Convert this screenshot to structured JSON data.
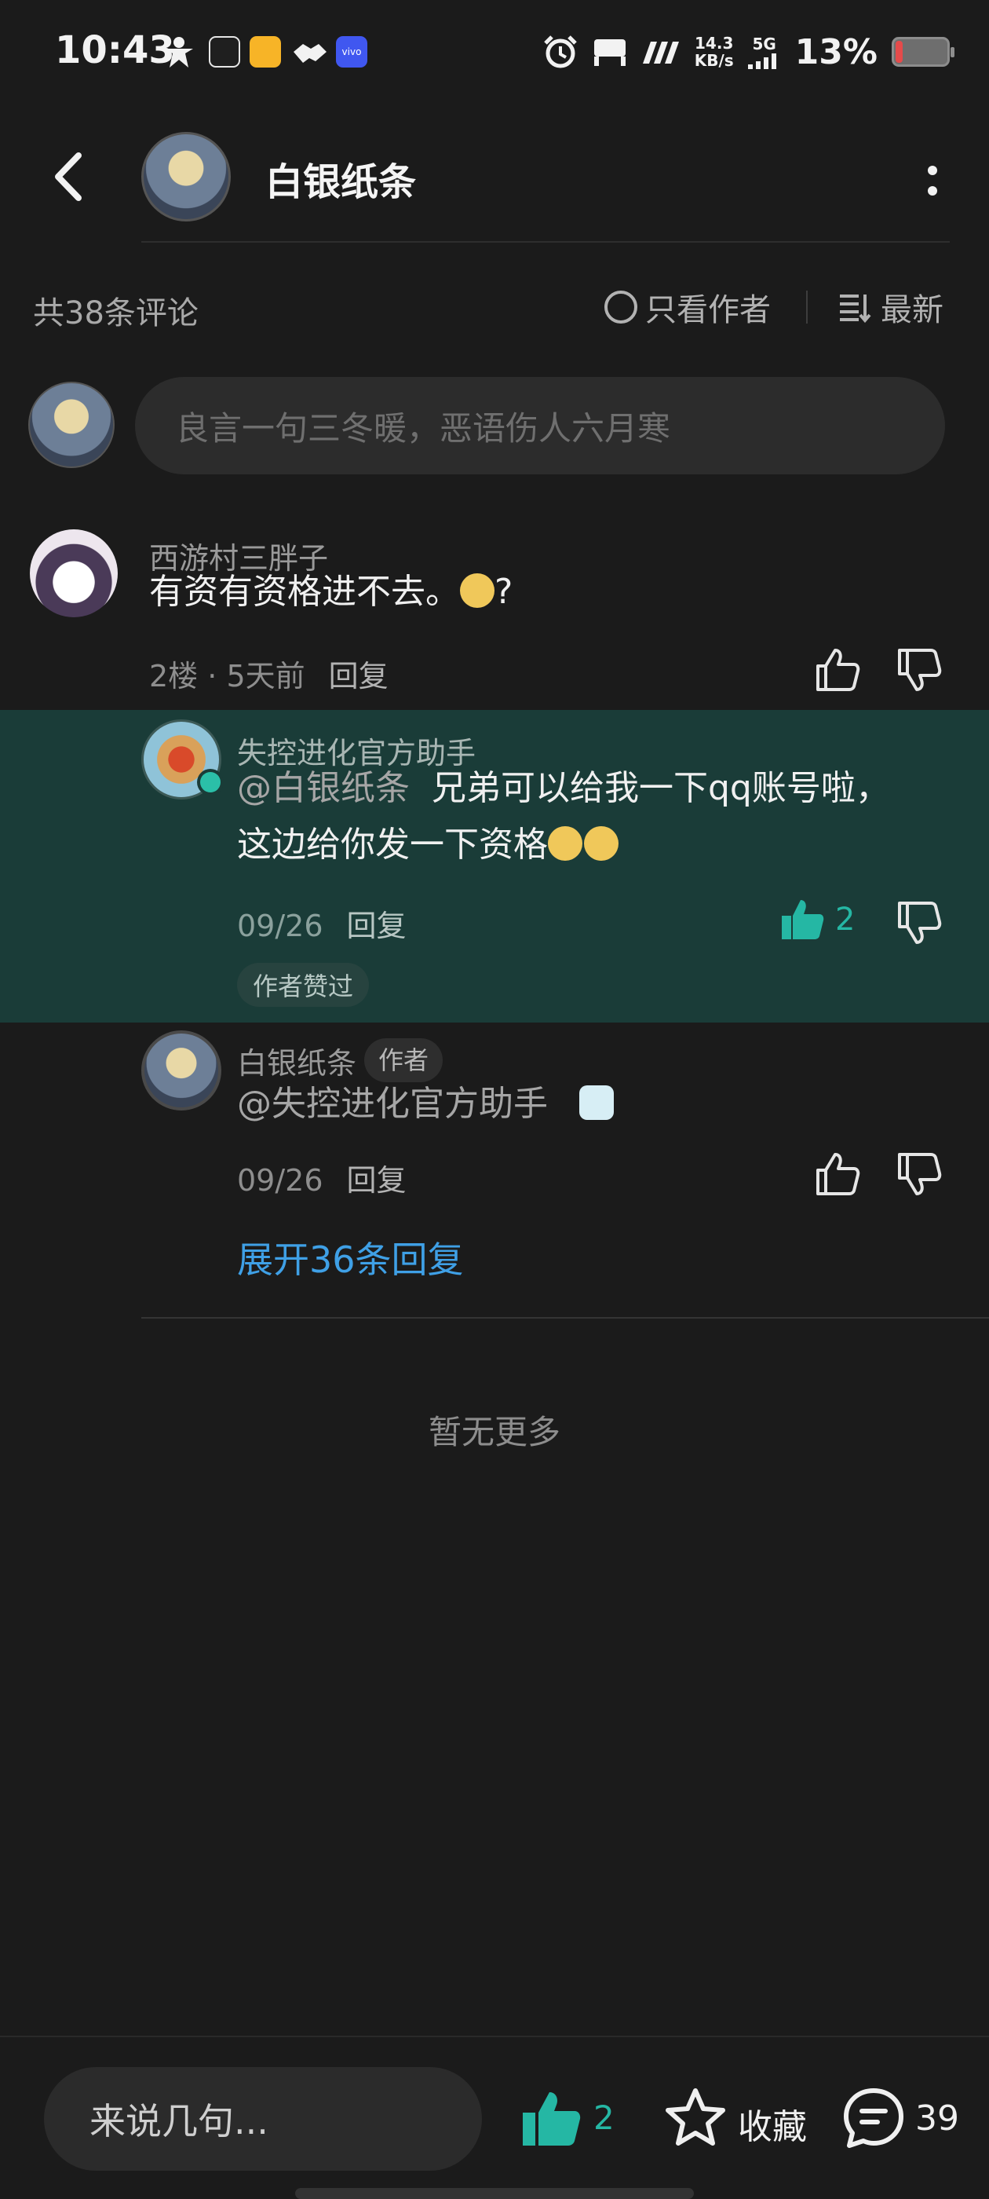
{
  "status_bar": {
    "time": "10:43",
    "net_speed_value": "14.3",
    "net_speed_unit": "KB/s",
    "network": "5G",
    "battery": "13%",
    "battery_level": 0.13,
    "app_icon_label": "vivo"
  },
  "header": {
    "title": "白银纸条"
  },
  "comments_meta": {
    "count_label": "共38条评论",
    "only_author_label": "只看作者",
    "sort_label": "最新"
  },
  "input": {
    "placeholder": "良言一句三冬暖，恶语伤人六月寒"
  },
  "comments": [
    {
      "author": "西游村三胖子",
      "text": "有资有资格进不去。",
      "text_suffix": "?",
      "floor": "2楼",
      "time": "5天前",
      "reply_label": "回复"
    }
  ],
  "replies": [
    {
      "author": "失控进化官方助手",
      "mention": "@白银纸条",
      "text_line1": "兄弟可以给我一下qq账号啦，",
      "text_line2": "这边给你发一下资格",
      "time": "09/26",
      "reply_label": "回复",
      "like_count": "2",
      "author_liked_label": "作者赞过"
    },
    {
      "author": "白银纸条",
      "author_tag": "作者",
      "mention": "@失控进化官方助手",
      "time": "09/26",
      "reply_label": "回复"
    }
  ],
  "expand_label": "展开36条回复",
  "no_more_label": "暂无更多",
  "bottom_bar": {
    "input_placeholder": "来说几句...",
    "like_count": "2",
    "favorite_label": "收藏",
    "comment_count": "39"
  },
  "colors": {
    "accent": "#25b7a4",
    "link": "#3fa0e6",
    "highlight_bg": "#1a3c38",
    "background": "#1b1b1b"
  }
}
